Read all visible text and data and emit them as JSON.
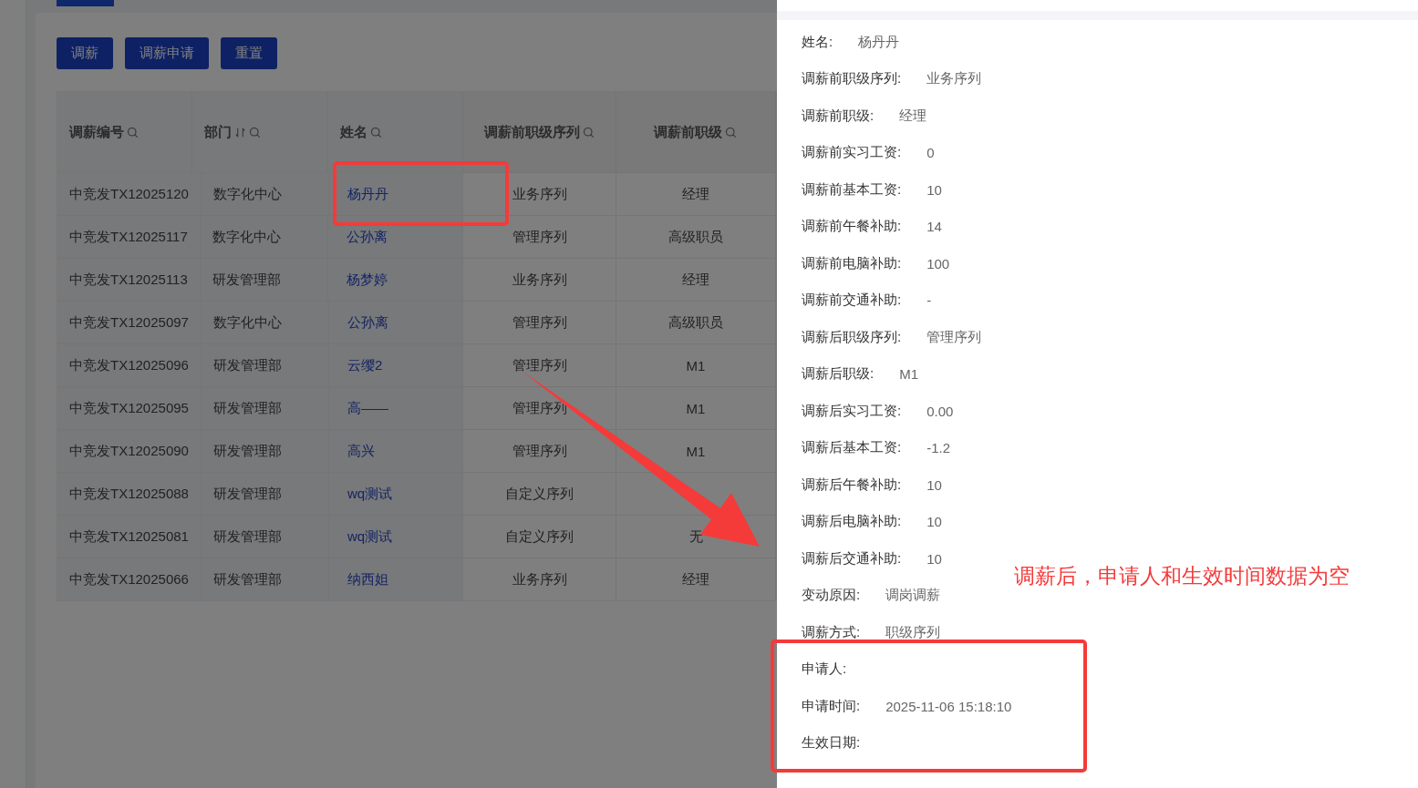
{
  "toolbar": {
    "buttons": [
      "调薪",
      "调薪申请",
      "重置"
    ]
  },
  "table": {
    "columns": [
      {
        "label": "调薪编号",
        "sortable": false
      },
      {
        "label": "部门",
        "sortable": true
      },
      {
        "label": "姓名",
        "sortable": false
      },
      {
        "label": "调薪前职级序列",
        "sortable": false
      },
      {
        "label": "调薪前职级",
        "sortable": false
      }
    ],
    "rows": [
      [
        "中竞发TX12025120",
        "数字化中心",
        "杨丹丹",
        "业务序列",
        "经理"
      ],
      [
        "中竞发TX12025117",
        "数字化中心",
        "公孙离",
        "管理序列",
        "高级职员"
      ],
      [
        "中竞发TX12025113",
        "研发管理部",
        "杨梦婷",
        "业务序列",
        "经理"
      ],
      [
        "中竞发TX12025097",
        "数字化中心",
        "公孙离",
        "管理序列",
        "高级职员"
      ],
      [
        "中竞发TX12025096",
        "研发管理部",
        "云缨2",
        "管理序列",
        "M1"
      ],
      [
        "中竞发TX12025095",
        "研发管理部",
        "高——",
        "管理序列",
        "M1"
      ],
      [
        "中竞发TX12025090",
        "研发管理部",
        "高兴",
        "管理序列",
        "M1"
      ],
      [
        "中竞发TX12025088",
        "研发管理部",
        "wq测试",
        "自定义序列"
      ],
      [
        "中竞发TX12025081",
        "研发管理部",
        "wq测试",
        "自定义序列",
        "无"
      ],
      [
        "中竞发TX12025066",
        "研发管理部",
        "纳西妲",
        "业务序列",
        "经理"
      ]
    ]
  },
  "drawer": {
    "fields": [
      {
        "label": "姓名:",
        "value": "杨丹丹"
      },
      {
        "label": "调薪前职级序列:",
        "value": "业务序列"
      },
      {
        "label": "调薪前职级:",
        "value": "经理"
      },
      {
        "label": "调薪前实习工资:",
        "value": "0"
      },
      {
        "label": "调薪前基本工资:",
        "value": "10"
      },
      {
        "label": "调薪前午餐补助:",
        "value": "14"
      },
      {
        "label": "调薪前电脑补助:",
        "value": "100"
      },
      {
        "label": "调薪前交通补助:",
        "value": "-"
      },
      {
        "label": "调薪后职级序列:",
        "value": "管理序列"
      },
      {
        "label": "调薪后职级:",
        "value": "M1"
      },
      {
        "label": "调薪后实习工资:",
        "value": "0.00"
      },
      {
        "label": "调薪后基本工资:",
        "value": "-1.2"
      },
      {
        "label": "调薪后午餐补助:",
        "value": "10"
      },
      {
        "label": "调薪后电脑补助:",
        "value": "10"
      },
      {
        "label": "调薪后交通补助:",
        "value": "10"
      },
      {
        "label": "变动原因:",
        "value": "调岗调薪"
      },
      {
        "label": "调薪方式:",
        "value": "职级序列"
      },
      {
        "label": "申请人:"
      },
      {
        "label": "申请时间:",
        "value": "2025-11-06 15:18:10"
      },
      {
        "label": "生效日期:"
      }
    ]
  },
  "annotation": "调薪后，申请人和生效时间数据为空"
}
